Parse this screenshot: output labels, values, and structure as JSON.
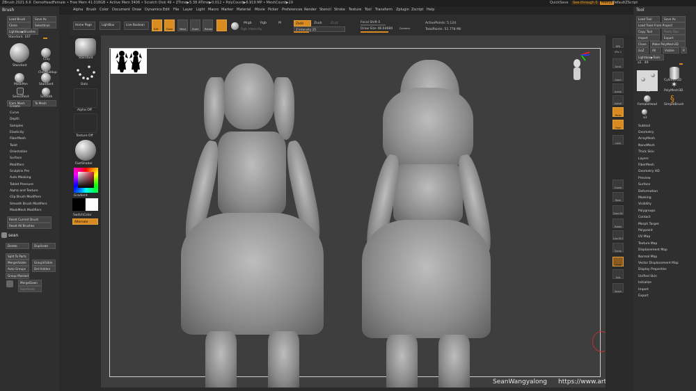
{
  "titlebar": {
    "app": "ZBrush 2021.6.6",
    "doc": "DemoHeadFemale",
    "stats": "• Free Mem 41.018GB • Active Mem 3406 • Scratch Disk 49 • ZTime▶5.38 ATime▶0.012 • PolyCount▶6.919 MP • MeshCount▶19",
    "quicksave": "QuickSave",
    "seethrough": "See-through 0",
    "menus": "Menus",
    "defaultscript": "DefaultZScript"
  },
  "menubar": {
    "items": [
      "Alpha",
      "Brush",
      "Color",
      "Document",
      "Draw",
      "Dynamics",
      "Edit",
      "File",
      "Layer",
      "Light",
      "Macro",
      "Marker",
      "Material",
      "Movie",
      "Picker",
      "Preferences",
      "Render",
      "Stencil",
      "Stroke",
      "Texture",
      "Tool",
      "Transform",
      "Zplugin",
      "Zscript",
      "Help"
    ]
  },
  "left": {
    "brush_title": "Brush",
    "load_brush": "Load Brush",
    "save_as": "Save As",
    "clone": "Clone",
    "select_icon": "SelectIcon",
    "lightbox_brushes": "Lightbox▶Brushes",
    "standard_val": "Standard. 167",
    "brush_grid": [
      "Standard",
      "Clay",
      "ClayBuildup",
      "MaskPen",
      "Standard",
      "SelectRect",
      "Smooth"
    ],
    "from_mesh": "From Mesh",
    "to_mesh": "To Mesh",
    "sections": [
      "Create",
      "Curve",
      "Depth",
      "Samples",
      "Elasticity",
      "FiberMesh",
      "Twist",
      "Orientation",
      "Surface",
      "Modifiers",
      "Sculptris Pro",
      "Auto Masking",
      "Tablet Pressure",
      "Alpha and Texture",
      "Clip Brush Modifiers",
      "Smooth Brush Modifiers",
      "MaskMesh Modifiers"
    ],
    "reset_current": "Reset Current Brush",
    "reset_all": "Reset All Brushes",
    "subtool_name": "sean",
    "delete": "Delete",
    "duplicate": "Duplicate",
    "split_to_parts": "Split To Parts",
    "merge_visible": "MergeVisible",
    "group_visible": "GroupVisible",
    "auto_groups": "Auto Groups",
    "del_hidden": "Del Hidden",
    "group_masked": "Group Masked",
    "merge_down": "MergeDown",
    "subdivide": "Subdivide"
  },
  "shelf": {
    "home_page": "Home Page",
    "lightbox": "LightBox",
    "live_boolean": "Live Boolean",
    "edit": "Edit",
    "draw": "Draw",
    "move": "Move",
    "scale": "Scale",
    "rotate": "Rotate",
    "mrgb": "Mrgb",
    "rgb": "Rgb",
    "m": "M",
    "zadd": "Zadd",
    "zsub": "Zsub",
    "zcut": "Zcut",
    "rgb_intensity": "Rgb Intensity",
    "z_intensity": "Z Intensity 25",
    "focal_shift": "Focal Shift 0",
    "draw_size": "Draw Size 48.64680",
    "dynamic": "Dynamic",
    "active_points": "ActivePoints: 5.124",
    "total_points": "TotalPoints: 51.778 Mil"
  },
  "leftshelf": {
    "standard": "Standard",
    "dots": "Dots",
    "alpha_off": "Alpha Off",
    "texture_off": "Texture Off",
    "fast_shader": "FastShader",
    "gradient": "Gradient",
    "switch_color": "SwitchColor",
    "alternate": "Alternate"
  },
  "rightshelf": {
    "items": [
      "BPR",
      "SPix 3",
      "Scroll",
      "Zoom",
      "Actual",
      "AAHalf",
      "Persp",
      "Floor",
      "Local",
      "Frame",
      "Move",
      "Zoom3D",
      "Rotate",
      "Line Fill PolyF",
      "Transp",
      "Ghost",
      "Solo",
      "Xpose"
    ]
  },
  "right": {
    "tool_title": "Tool",
    "load_tool": "Load Tool",
    "save_as": "Save As",
    "load_tools_from_project": "Load Tools From Project",
    "copy_tool": "Copy Tool",
    "paste_tool": "Paste Tool",
    "import": "Import",
    "export": "Export",
    "clone": "Clone",
    "make_polymesh": "Make PolyMesh3D",
    "goz": "GoZ",
    "all": "All",
    "visible": "Visible",
    "r": "R",
    "lightbox_tools": "Lightbox▶Tools",
    "tool_val": "a1 . 49",
    "thumbs": [
      "a1",
      "Cylinder3D",
      "PolyMesh3D",
      "FemaleHead",
      "SimpleBrush",
      "a1"
    ],
    "sections": [
      "Subtool",
      "Geometry",
      "ArrayMesh",
      "NanoMesh",
      "Thick Skin",
      "Layers",
      "FiberMesh",
      "Geometry HD",
      "Preview",
      "Surface",
      "Deformation",
      "Masking",
      "Visibility",
      "Polygroups",
      "Contact",
      "Morph Target",
      "Polypaint",
      "UV Map",
      "Texture Map",
      "Displacement Map",
      "Normal Map",
      "Vector Displacement Map",
      "Display Properties",
      "Unified Skin",
      "Initialize",
      "Import",
      "Export"
    ]
  },
  "watermark": {
    "author": "SeanWangyalong",
    "url": "https://www.artstation.com/wangyalong"
  },
  "colors": {
    "accent": "#d98a20",
    "panel": "#2f2f2f",
    "canvas": "#3e3e3e"
  }
}
